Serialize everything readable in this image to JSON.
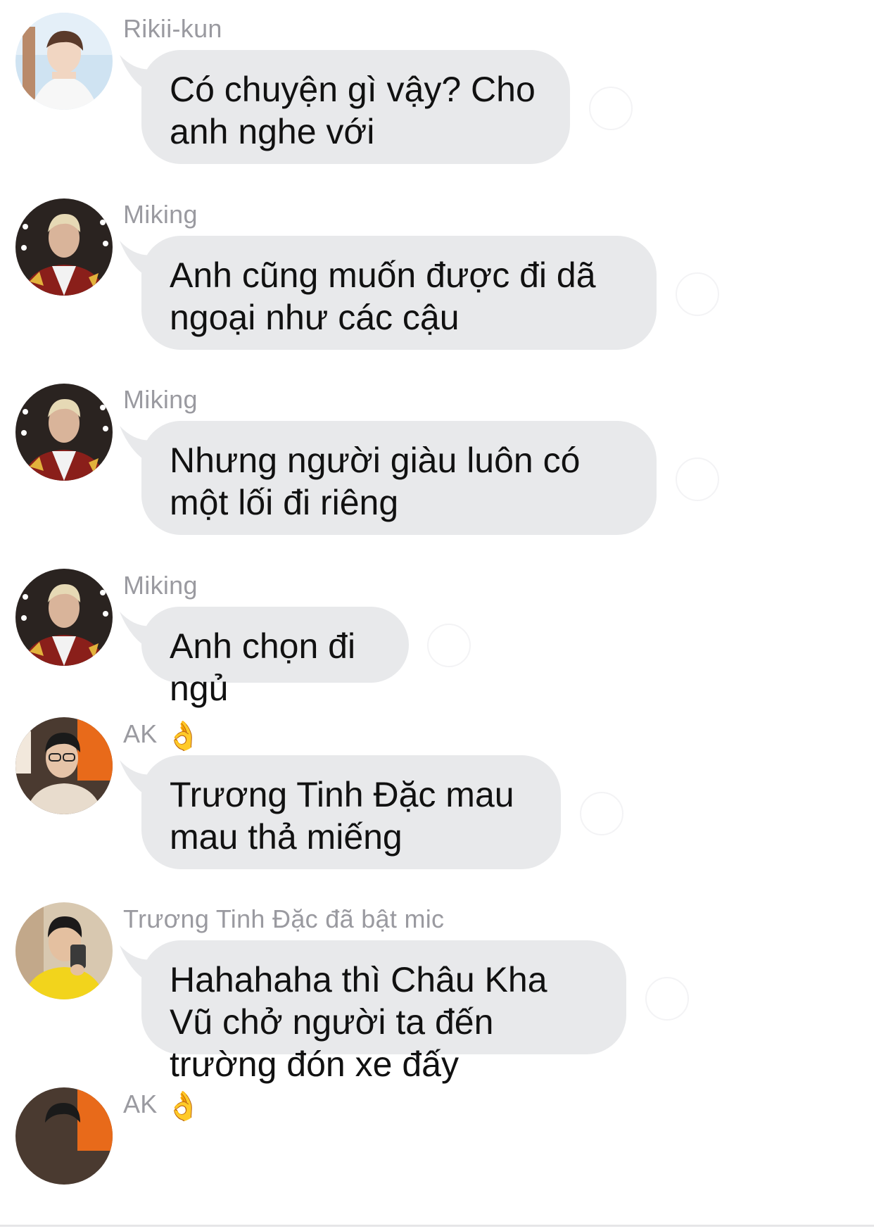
{
  "messages": [
    {
      "sender": "Rikii-kun",
      "sender_emoji": "",
      "text": "Có chuyện gì vậy? Cho anh nghe với",
      "avatar": "rikii-avatar"
    },
    {
      "sender": "Miking",
      "sender_emoji": "",
      "text": "Anh cũng muốn được đi dã ngoại như các cậu",
      "avatar": "miking-avatar"
    },
    {
      "sender": "Miking",
      "sender_emoji": "",
      "text": "Nhưng người giàu luôn có một lối đi riêng",
      "avatar": "miking-avatar"
    },
    {
      "sender": "Miking",
      "sender_emoji": "",
      "text": "Anh chọn đi ngủ",
      "avatar": "miking-avatar"
    },
    {
      "sender": "AK",
      "sender_emoji": "👌",
      "text": "Trương Tinh Đặc mau mau thả miếng",
      "avatar": "ak-avatar"
    },
    {
      "sender": "Trương Tinh Đặc đã bật mic",
      "sender_emoji": "",
      "text": "Hahahaha thì Châu Kha Vũ chở người ta đến trường đón xe đấy",
      "avatar": "truong-avatar"
    }
  ],
  "partial_next": {
    "sender": "AK",
    "sender_emoji": "👌"
  },
  "colors": {
    "bubble": "#e8e9eb",
    "sender_text": "#9a9aa0",
    "message_text": "#111111",
    "background": "#ffffff"
  }
}
